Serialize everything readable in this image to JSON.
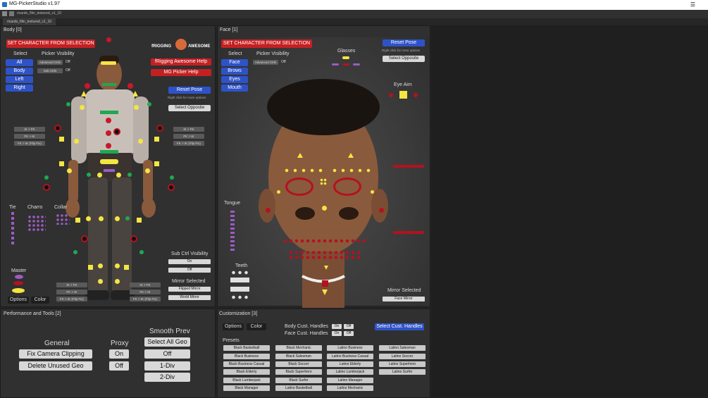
{
  "window": {
    "title": "MG-PickerStudio v1.97",
    "menu_icon": "hamburger-icon",
    "file_name": "ricardo_film_textured_v1_10",
    "tab_label": "ricardo_film_textured_v1_10"
  },
  "colors": {
    "red_button": "#c42022",
    "blue_button": "#2e53c8",
    "yellow_ctrl": "#f4e542",
    "green_ctrl": "#1fa850",
    "purple_ctrl": "#9b5cc2"
  },
  "body": {
    "header": "Body [0]",
    "set_character": "SET CHARACTER FROM SELECTION",
    "select_label": "Select",
    "select_buttons": [
      "All",
      "Body",
      "Left",
      "Right"
    ],
    "picker_visibility_label": "Picker Visibility",
    "advanced_ctrls": "Advanced Ctrls",
    "advanced_value": "Off",
    "sub_ctrls": "Sub Ctrls",
    "sub_value": "Off",
    "logo_left": "fRIGGING",
    "logo_right": "AWESOME",
    "help_buttons": [
      "fRigging Awesome Help",
      "MG Picker Help"
    ],
    "reset_pose": "Reset Pose",
    "reset_hint": "Right click for more options",
    "select_opposite": "Select Opposite",
    "ik_fk_left_arm": [
      "IK > FK",
      "FK > IK",
      "FK > IK (Flip Fix)"
    ],
    "ik_fk_right_arm": [
      "IK > FK",
      "FK > IK",
      "FK > IK (Flip Fix)"
    ],
    "ik_fk_left_leg": [
      "IK > FK",
      "FK > IK",
      "FK > IK (Flip Fix)"
    ],
    "ik_fk_right_leg": [
      "IK > FK",
      "FK > IK",
      "FK > IK (Flip Fix)"
    ],
    "tie_label": "Tie",
    "charro_label": "Charro",
    "collar_label": "Collar",
    "master_label": "Master",
    "options_label": "Options",
    "color_label": "Color",
    "sub_ctrl_visibility": "Sub Ctrl Visibility",
    "on_label": "On",
    "off_label": "Off",
    "mirror_selected": "Mirror Selected",
    "flipped_mirror": "Flipped Mirror",
    "world_mirror": "World Mirror"
  },
  "face": {
    "header": "Face [1]",
    "set_character": "SET CHARACTER FROM SELECTION",
    "select_label": "Select",
    "select_buttons": [
      "Face",
      "Brows",
      "Eyes",
      "Mouth"
    ],
    "picker_visibility_label": "Picker Visibility",
    "advanced_ctrls": "Advanced Ctrls",
    "advanced_value": "Off",
    "glasses_label": "Glasses",
    "reset_pose": "Reset Pose",
    "reset_hint": "Right click for more options",
    "select_opposite": "Select Opposite",
    "eye_aim_label": "Eye Aim",
    "tongue_label": "Tongue",
    "teeth_label": "Teeth",
    "mirror_selected": "Mirror Selected",
    "face_mirror": "Face Mirror"
  },
  "performance": {
    "header": "Performance and Tools [2]",
    "general_label": "General",
    "general_buttons": [
      "Fix Camera Clipping",
      "Delete Unused Geo"
    ],
    "proxy_label": "Proxy",
    "proxy_buttons": [
      "On",
      "Off"
    ],
    "smooth_label": "Smooth Prev",
    "smooth_buttons": [
      "Select All Geo",
      "Off",
      "1-Div",
      "2-Div"
    ]
  },
  "customization": {
    "header": "Customization [3]",
    "options_label": "Options",
    "color_label": "Color",
    "body_handles": "Body Cust. Handles",
    "face_handles": "Face Cust. Handles",
    "on_label": "On",
    "off_label": "Off",
    "select_handles": "Select Cust. Handles",
    "presets_label": "Presets",
    "presets": [
      [
        "Black Basketball",
        "Black Business",
        "Black Business Casual",
        "Black Elderly",
        "Black Lumberjack",
        "Black Manager"
      ],
      [
        "Black Mechanic",
        "Black Salesman",
        "Black Soccer",
        "Black Superhero",
        "Black Surfer",
        "Latino Basketball"
      ],
      [
        "Latino Business",
        "Latino Business Casual",
        "Latino Elderly",
        "Latino Lumberjack",
        "Latino Manager",
        "Latino Mechanic"
      ],
      [
        "Latino Salesman",
        "Latino Soccer",
        "Latino Superhero",
        "Latino Surfer"
      ]
    ]
  }
}
